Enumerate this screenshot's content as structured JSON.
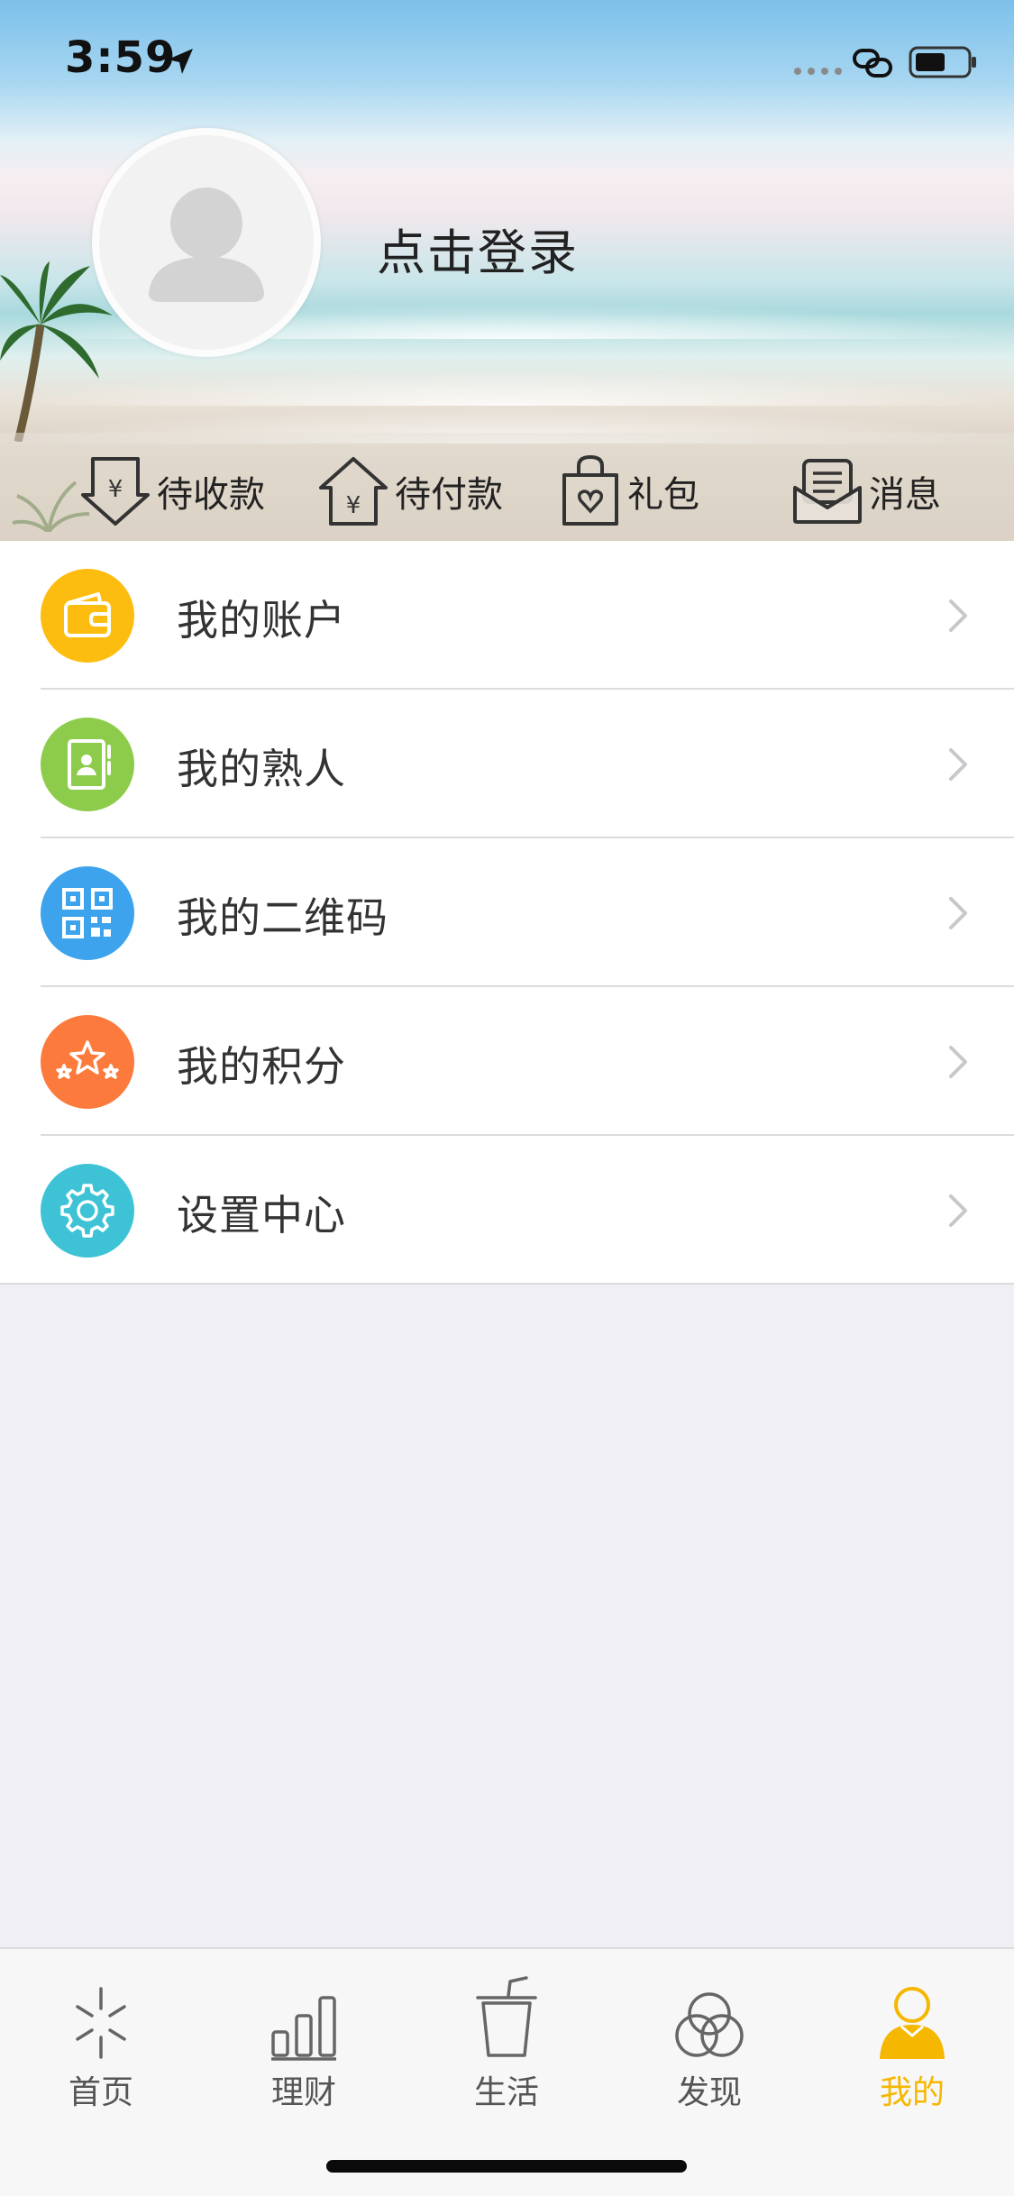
{
  "status_bar": {
    "time": "3:59"
  },
  "header": {
    "login_label": "点击登录"
  },
  "quick_actions": [
    {
      "label": "待收款",
      "icon": "receive-money-icon"
    },
    {
      "label": "待付款",
      "icon": "pay-money-icon"
    },
    {
      "label": "礼包",
      "icon": "gift-bag-icon"
    },
    {
      "label": "消息",
      "icon": "message-icon"
    }
  ],
  "menu": [
    {
      "label": "我的账户",
      "icon": "wallet-icon",
      "color": "#fdbd10"
    },
    {
      "label": "我的熟人",
      "icon": "contacts-icon",
      "color": "#8dcc4b"
    },
    {
      "label": "我的二维码",
      "icon": "qr-code-icon",
      "color": "#3ca3ec"
    },
    {
      "label": "我的积分",
      "icon": "stars-icon",
      "color": "#fb7a3c"
    },
    {
      "label": "设置中心",
      "icon": "gear-icon",
      "color": "#3ec3d6"
    }
  ],
  "tabbar": [
    {
      "label": "首页",
      "icon": "home-sparkle-icon",
      "active": false
    },
    {
      "label": "理财",
      "icon": "bar-chart-icon",
      "active": false
    },
    {
      "label": "生活",
      "icon": "cup-icon",
      "active": false
    },
    {
      "label": "发现",
      "icon": "discover-circles-icon",
      "active": false
    },
    {
      "label": "我的",
      "icon": "person-icon",
      "active": true
    }
  ],
  "colors": {
    "accent": "#f5b700",
    "background": "#efeff4"
  }
}
